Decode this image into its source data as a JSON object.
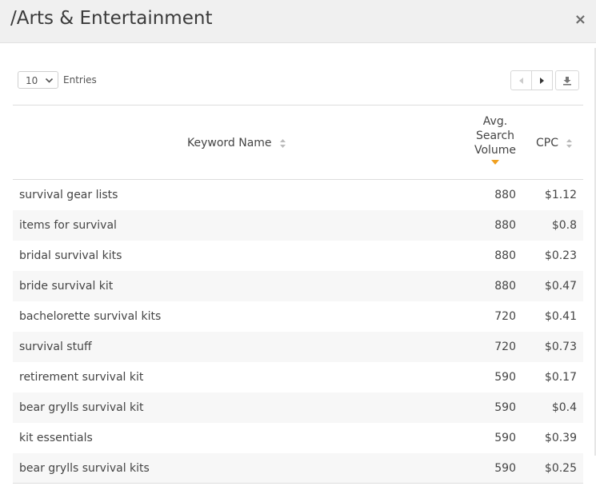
{
  "modal": {
    "title": "/Arts & Entertainment",
    "close_label": "×"
  },
  "toolbar": {
    "page_size": "10",
    "entries_label": "Entries"
  },
  "table": {
    "columns": {
      "keyword": "Keyword Name",
      "volume": [
        "Avg.",
        "Search",
        "Volume"
      ],
      "cpc": "CPC"
    },
    "sorted_column": "volume",
    "sort_direction": "descending",
    "rows": [
      {
        "keyword": "survival gear lists",
        "volume": "880",
        "cpc": "$1.12"
      },
      {
        "keyword": "items for survival",
        "volume": "880",
        "cpc": "$0.8"
      },
      {
        "keyword": "bridal survival kits",
        "volume": "880",
        "cpc": "$0.23"
      },
      {
        "keyword": "bride survival kit",
        "volume": "880",
        "cpc": "$0.47"
      },
      {
        "keyword": "bachelorette survival kits",
        "volume": "720",
        "cpc": "$0.41"
      },
      {
        "keyword": "survival stuff",
        "volume": "720",
        "cpc": "$0.73"
      },
      {
        "keyword": "retirement survival kit",
        "volume": "590",
        "cpc": "$0.17"
      },
      {
        "keyword": "bear grylls survival kit",
        "volume": "590",
        "cpc": "$0.4"
      },
      {
        "keyword": "kit essentials",
        "volume": "590",
        "cpc": "$0.39"
      },
      {
        "keyword": "bear grylls survival kits",
        "volume": "590",
        "cpc": "$0.25"
      }
    ]
  },
  "colors": {
    "header_bg": "#f0f0f0",
    "sort_active": "#f0a020",
    "row_alt_bg": "#f7f7f7"
  },
  "icons": [
    "close-icon",
    "chevron-down-icon",
    "prev-page-icon",
    "next-page-icon",
    "download-icon",
    "sort-icon",
    "sort-desc-icon"
  ]
}
